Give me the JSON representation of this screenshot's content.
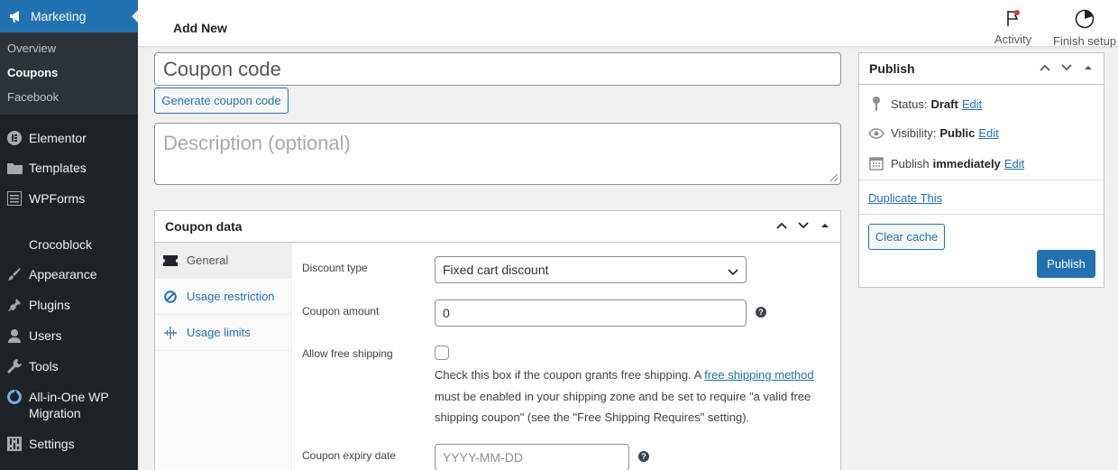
{
  "sidebar": {
    "current": {
      "label": "Marketing",
      "icon": "megaphone-icon"
    },
    "submenu": [
      "Overview",
      "Coupons",
      "Facebook"
    ],
    "items": [
      {
        "label": "Elementor",
        "icon": "elementor-icon"
      },
      {
        "label": "Templates",
        "icon": "folder-icon"
      },
      {
        "label": "WPForms",
        "icon": "forms-icon"
      },
      {
        "label": "Crocoblock",
        "icon": ""
      },
      {
        "label": "Appearance",
        "icon": "paintbrush-icon"
      },
      {
        "label": "Plugins",
        "icon": "plug-icon"
      },
      {
        "label": "Users",
        "icon": "user-icon"
      },
      {
        "label": "Tools",
        "icon": "wrench-icon"
      },
      {
        "label": "All-in-One WP Migration",
        "icon": "migration-icon"
      },
      {
        "label": "Settings",
        "icon": "settings-icon"
      }
    ]
  },
  "header": {
    "title": "Add New",
    "activity_label": "Activity",
    "finish_setup_label": "Finish setup"
  },
  "form": {
    "coupon_code_placeholder": "Coupon code",
    "generate_label": "Generate coupon code",
    "description_placeholder": "Description (optional)"
  },
  "coupon_data": {
    "title": "Coupon data",
    "tabs": [
      {
        "label": "General",
        "icon": "ticket-icon"
      },
      {
        "label": "Usage restriction",
        "icon": "ban-icon"
      },
      {
        "label": "Usage limits",
        "icon": "limits-icon"
      }
    ],
    "discount_type_label": "Discount type",
    "discount_type_value": "Fixed cart discount",
    "coupon_amount_label": "Coupon amount",
    "coupon_amount_value": "0",
    "free_shipping_label": "Allow free shipping",
    "free_shipping_desc_1": "Check this box if the coupon grants free shipping. A ",
    "free_shipping_link": "free shipping method",
    "free_shipping_desc_2": " must be enabled in your shipping zone and be set to require \"a valid free shipping coupon\" (see the \"Free Shipping Requires\" setting).",
    "expiry_label": "Coupon expiry date",
    "expiry_placeholder": "YYYY-MM-DD"
  },
  "publish": {
    "title": "Publish",
    "status_label": "Status:",
    "status_value": "Draft",
    "visibility_label": "Visibility:",
    "visibility_value": "Public",
    "publish_label": "Publish",
    "publish_value": "immediately",
    "edit_label": "Edit",
    "duplicate_label": "Duplicate This",
    "clear_cache_label": "Clear cache",
    "publish_button": "Publish"
  },
  "colors": {
    "sidebar_bg": "#1d2327",
    "accent": "#2271b1",
    "page_bg": "#f0f0f1"
  }
}
